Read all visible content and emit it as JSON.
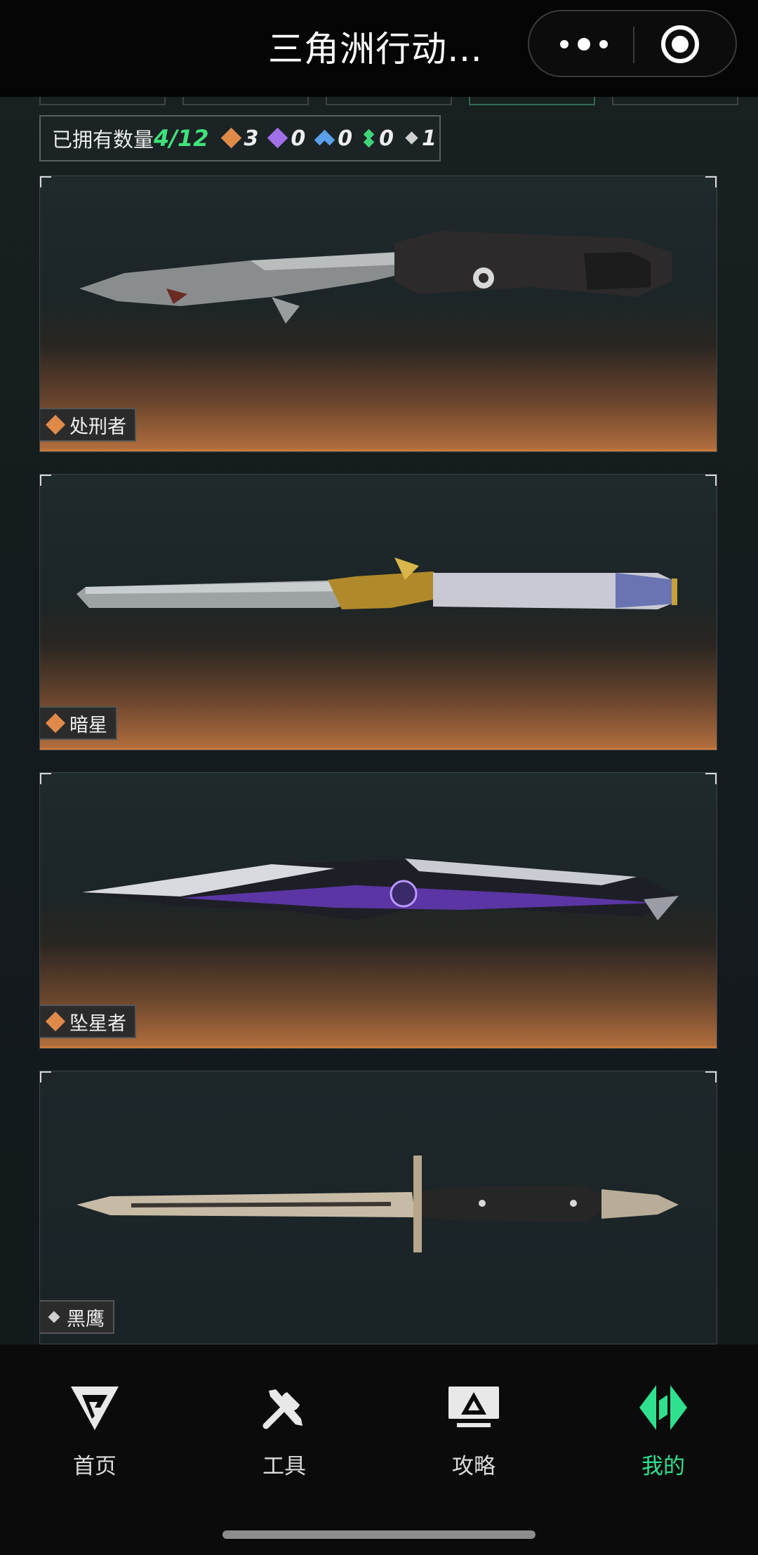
{
  "header": {
    "title": "三角洲行动…"
  },
  "inventory": {
    "count_label": "已拥有数量",
    "count_value": "4/12",
    "rarity_counts": [
      {
        "icon": "orange-gem-icon",
        "color": "#e08a4a",
        "value": "3"
      },
      {
        "icon": "purple-gem-icon",
        "color": "#a070e8",
        "value": "0"
      },
      {
        "icon": "blue-gem-icon",
        "color": "#5aa0e8",
        "value": "0"
      },
      {
        "icon": "green-gem-icon",
        "color": "#3fd47a",
        "value": "0"
      },
      {
        "icon": "white-gem-icon",
        "color": "#d0d0d0",
        "value": "1"
      }
    ]
  },
  "items": [
    {
      "name": "处刑者",
      "rarity": "orange",
      "rarity_color": "#e08a4a"
    },
    {
      "name": "暗星",
      "rarity": "orange",
      "rarity_color": "#e08a4a"
    },
    {
      "name": "坠星者",
      "rarity": "orange",
      "rarity_color": "#e08a4a"
    },
    {
      "name": "黑鹰",
      "rarity": "white",
      "rarity_color": "#d0d0d0"
    }
  ],
  "nav": {
    "items": [
      {
        "label": "首页",
        "icon": "home-logo-icon",
        "active": false
      },
      {
        "label": "工具",
        "icon": "tools-icon",
        "active": false
      },
      {
        "label": "攻略",
        "icon": "guide-monitor-icon",
        "active": false
      },
      {
        "label": "我的",
        "icon": "profile-logo-icon",
        "active": true
      }
    ],
    "active_color": "#2fe08f"
  }
}
